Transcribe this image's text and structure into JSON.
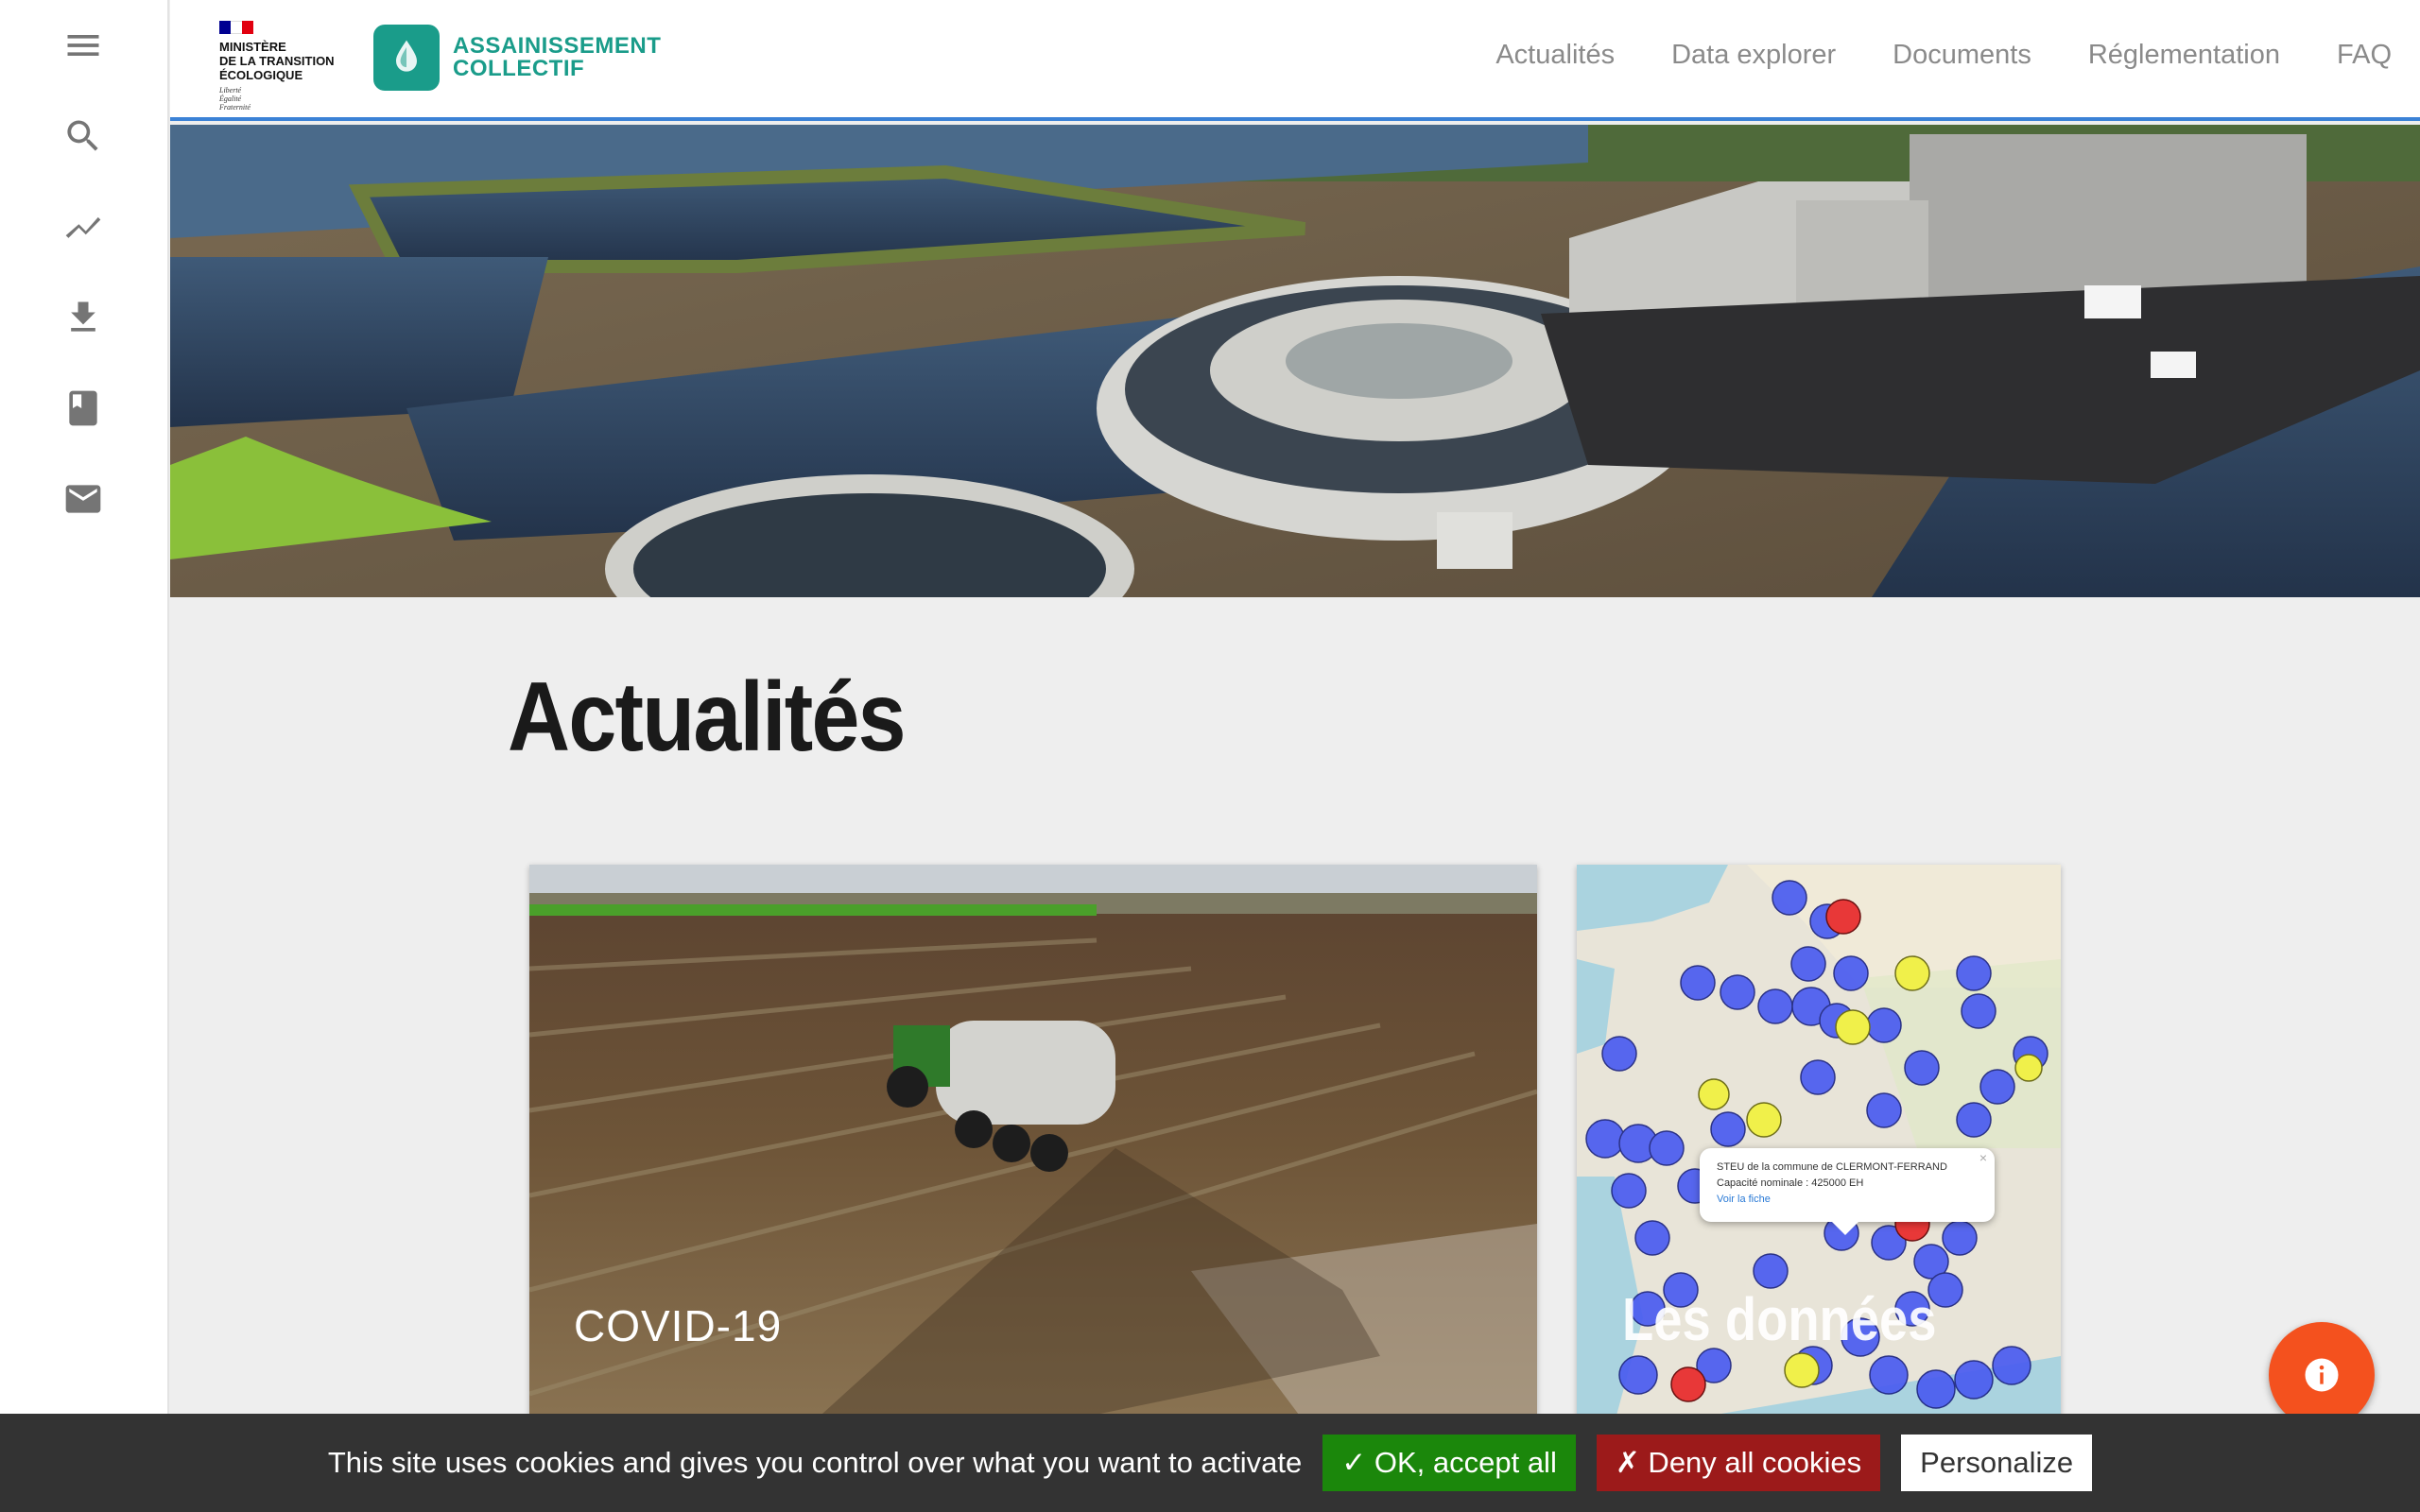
{
  "sidebar": {
    "items": [
      {
        "icon": "menu-icon"
      },
      {
        "icon": "search-icon"
      },
      {
        "icon": "trending-icon"
      },
      {
        "icon": "download-icon"
      },
      {
        "icon": "book-icon"
      },
      {
        "icon": "mail-icon"
      }
    ]
  },
  "header": {
    "gov_text": "MINISTÈRE\nDE LA TRANSITION\nÉCOLOGIQUE",
    "gov_motto": "Liberté\nÉgalité\nFraternité",
    "brand_text": "ASSAINISSEMENT\nCOLLECTIF",
    "nav": [
      "Actualités",
      "Data explorer",
      "Documents",
      "Réglementation",
      "FAQ"
    ]
  },
  "main": {
    "title": "Actualités",
    "cards": [
      {
        "label": "COVID-19"
      },
      {
        "label": "Les données"
      }
    ],
    "map_popup": {
      "line1": "STEU de la commune de CLERMONT-FERRAND",
      "line2": "Capacité nominale : 425000 EH",
      "link": "Voir la fiche",
      "close": "×"
    }
  },
  "cookie_bar": {
    "text": "This site uses cookies and gives you control over what you want to activate",
    "accept": "✓ OK, accept all",
    "deny": "✗ Deny all cookies",
    "personalize": "Personalize"
  },
  "colors": {
    "brand": "#1a9c8a",
    "header_border": "#3b82d6",
    "fab": "#f4511e",
    "accept": "#1b870b",
    "deny": "#9c1a1a"
  }
}
